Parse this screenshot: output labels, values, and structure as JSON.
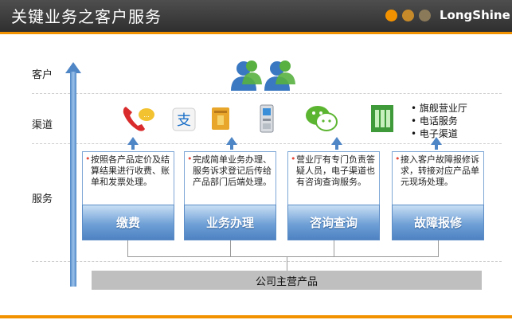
{
  "header": {
    "title": "关键业务之客户服务",
    "logo": "LongShine",
    "dot_colors": [
      "#f39200",
      "#c78a2a",
      "#8b7a5a"
    ]
  },
  "rows": {
    "customer": "客户",
    "channel": "渠道",
    "service": "服务"
  },
  "channels_list": [
    "旗舰营业厅",
    "电话服务",
    "电子渠道"
  ],
  "services": [
    {
      "label": "缴费",
      "desc": "按照各产品定价及结算结果进行收费、账单和发票处理。"
    },
    {
      "label": "业务办理",
      "desc": "完成简单业务办理、服务诉求登记后传给产品部门后端处理。"
    },
    {
      "label": "咨询查询",
      "desc": "营业厅有专门负责答疑人员，电子渠道也有咨询查询服务。"
    },
    {
      "label": "故障报修",
      "desc": "接入客户故障报修诉求，转接对应产品单元现场处理。"
    }
  ],
  "base_label": "公司主营产品",
  "icons": [
    "users-icon",
    "phone-icon",
    "alipay-icon",
    "bank-card-icon",
    "atm-kiosk-icon",
    "wechat-icon",
    "building-icon"
  ],
  "colors": {
    "accent": "#f39200",
    "blue": "#4f86c6"
  }
}
